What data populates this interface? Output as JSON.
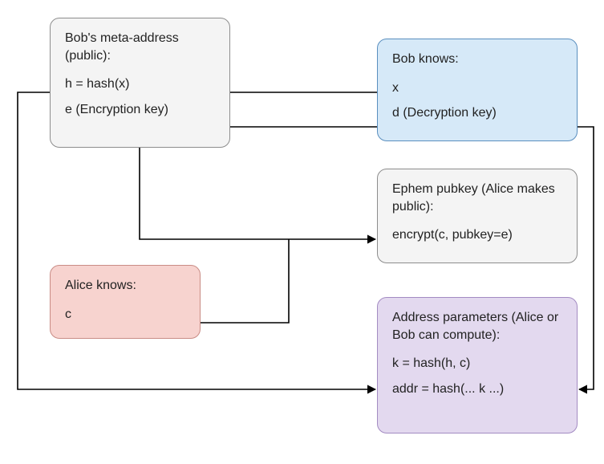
{
  "meta": {
    "title": "Bob's meta-address (public):",
    "h": "h = hash(x)",
    "e": "e (Encryption key)"
  },
  "bob": {
    "title": "Bob knows:",
    "x": "x",
    "d": "d (Decryption key)"
  },
  "ephem": {
    "title": "Ephem pubkey (Alice makes public):",
    "enc": "encrypt(c, pubkey=e)"
  },
  "alice": {
    "title": "Alice knows:",
    "c": "c"
  },
  "params": {
    "title": "Address parameters (Alice or Bob can compute):",
    "k": "k = hash(h, c)",
    "addr": "addr = hash(... k ...)"
  }
}
